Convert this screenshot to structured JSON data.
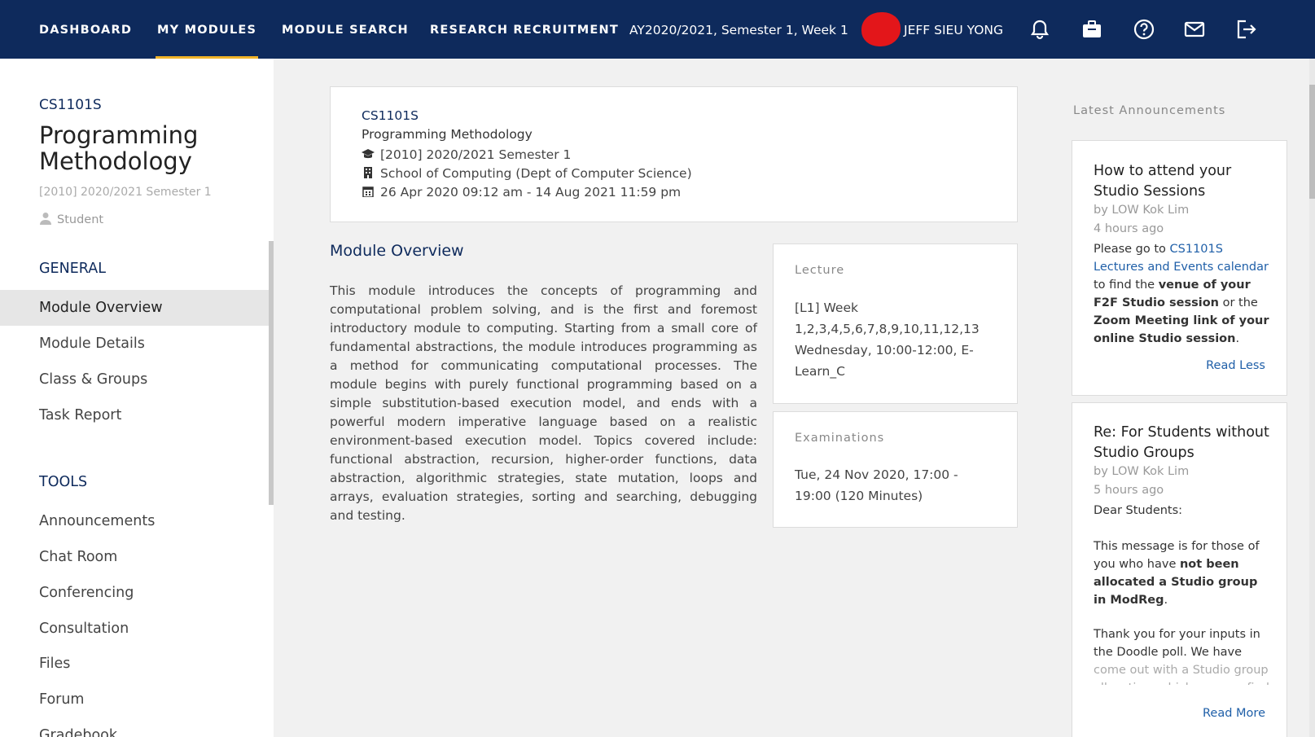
{
  "nav": {
    "dashboard": "DASHBOARD",
    "my_modules": "MY MODULES",
    "module_search": "MODULE SEARCH",
    "research_recruitment": "RESEARCH RECRUITMENT",
    "term": "AY2020/2021, Semester 1, Week 1",
    "username": "JEFF SIEU YONG",
    "icons": [
      "bell-icon",
      "briefcase-icon",
      "help-icon",
      "mail-icon",
      "logout-icon"
    ]
  },
  "sidebar": {
    "code": "CS1101S",
    "title": "Programming Methodology",
    "term": "[2010] 2020/2021 Semester 1",
    "role": "Student",
    "general_heading": "GENERAL",
    "general_items": [
      "Module Overview",
      "Module Details",
      "Class & Groups",
      "Task Report"
    ],
    "tools_heading": "TOOLS",
    "tools_items": [
      "Announcements",
      "Chat Room",
      "Conferencing",
      "Consultation",
      "Files",
      "Forum",
      "Gradebook"
    ]
  },
  "module_card": {
    "code": "CS1101S",
    "name": "Programming Methodology",
    "term": "[2010] 2020/2021 Semester 1",
    "faculty": "School of Computing (Dept of Computer Science)",
    "dates": "26 Apr 2020 09:12 am - 14 Aug 2021 11:59 pm"
  },
  "overview": {
    "heading": "Module Overview",
    "body": "This module introduces the concepts of programming and computational problem solving, and is the first and foremost introductory module to computing. Starting from a small core of fundamental abstractions, the module introduces programming as a method for communicating computational processes. The module begins with purely functional programming based on a simple substitution-based execution model, and ends with a powerful modern imperative language based on a realistic environment-based execution model. Topics covered include: functional abstraction, recursion, higher-order functions, data abstraction, algorithmic strategies, state mutation, loops and arrays, evaluation strategies, sorting and searching, debugging and testing."
  },
  "lecture": {
    "label": "Lecture",
    "text": "[L1] Week 1,2,3,4,5,6,7,8,9,10,11,12,13 Wednesday, 10:00-12:00, E-Learn_C"
  },
  "exams": {
    "label": "Examinations",
    "text": "Tue, 24 Nov 2020, 17:00 - 19:00 (120 Minutes)"
  },
  "announcements": {
    "heading": "Latest Announcements",
    "items": [
      {
        "title": "How to attend your Studio Sessions",
        "author": "by LOW Kok Lim",
        "time": "4 hours ago",
        "p1": "Please go to ",
        "link": "CS1101S Lectures and Events calendar",
        "p2": " to find the ",
        "b1": "venue of your F2F Studio session",
        "p3": " or the ",
        "b2": "Zoom Meeting link of your online Studio session",
        "p4": ".",
        "action": "Read Less"
      },
      {
        "title": "Re: For Students without Studio Groups",
        "author": "by LOW Kok Lim",
        "time": "5 hours ago",
        "greeting": "Dear Students:",
        "p1": "This message is for those of you who have ",
        "b1": "not been allocated a Studio group in ModReg",
        "p2": ".",
        "p3": "Thank you for your inputs in the Doodle poll.  We have ",
        "p3_fade": "come out with a Studio group allocation, which you can find",
        "action": "Read More"
      }
    ]
  }
}
